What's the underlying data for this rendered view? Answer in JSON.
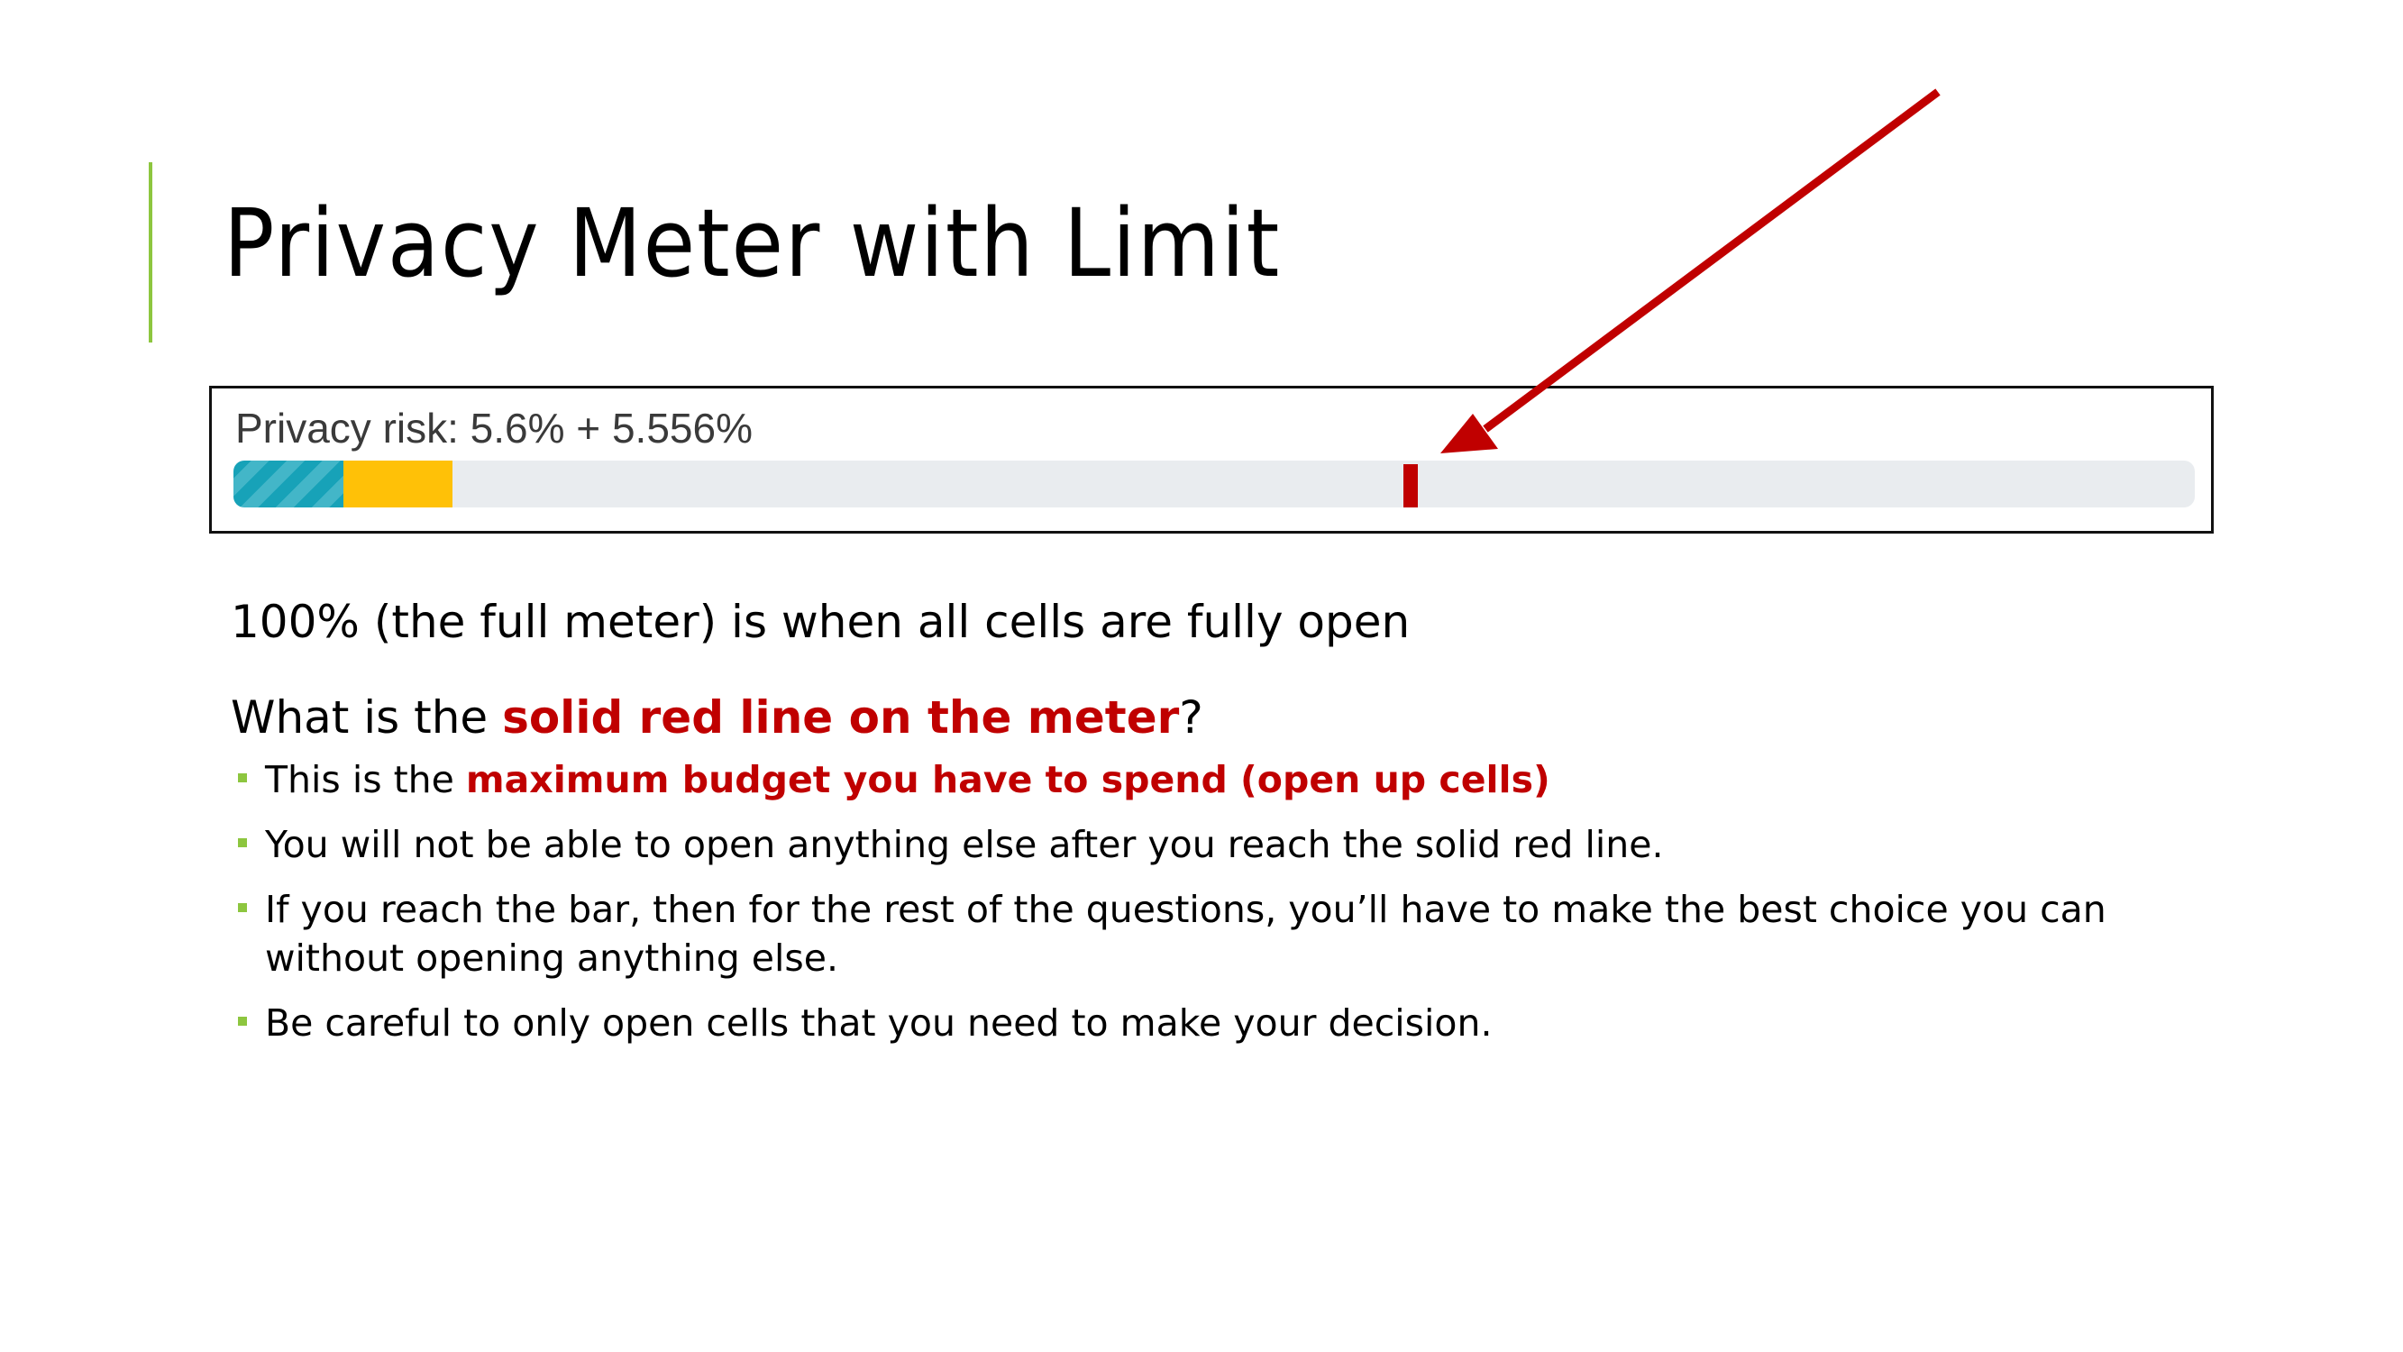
{
  "colors": {
    "accent": "#8dc63f",
    "highlight_red": "#c00000",
    "meter_used": "#17a2b8",
    "meter_pending": "#ffc107",
    "meter_track": "#e9ecef",
    "limit_line": "#c00000",
    "arrow": "#c00000"
  },
  "title": "Privacy Meter with Limit",
  "meter": {
    "label": "Privacy risk: 5.6% + 5.556%",
    "used_fraction": 0.056,
    "pending_fraction": 0.05556,
    "limit_fraction": 0.6
  },
  "full_meter_text": "100% (the full meter) is when all cells are fully open",
  "question": {
    "prefix": "What is the ",
    "highlight": "solid red line on the meter",
    "suffix": "?"
  },
  "bullets": [
    {
      "prefix": "This is the ",
      "highlight": "maximum budget you have to spend (open up cells)",
      "suffix": ""
    },
    {
      "prefix": "You will not be able to open anything else after you reach the solid red line.",
      "highlight": "",
      "suffix": ""
    },
    {
      "prefix": "If you reach the bar, then for the rest of the questions, you’ll have to make the best choice you can without opening anything else.",
      "highlight": "",
      "suffix": ""
    },
    {
      "prefix": "Be careful to only open cells that you need to make your decision.",
      "highlight": "",
      "suffix": ""
    }
  ]
}
